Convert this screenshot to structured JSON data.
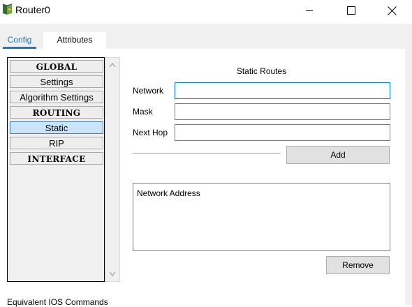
{
  "window": {
    "title": "Router0",
    "icon": "router-app-icon",
    "controls": {
      "minimize": "minimize-icon",
      "maximize": "maximize-icon",
      "close": "close-icon"
    }
  },
  "tabs": [
    {
      "label": "Config",
      "active": true
    },
    {
      "label": "Attributes",
      "active": false
    }
  ],
  "sidebar": {
    "items": [
      {
        "label": "GLOBAL",
        "type": "header"
      },
      {
        "label": "Settings",
        "type": "item"
      },
      {
        "label": "Algorithm Settings",
        "type": "item"
      },
      {
        "label": "ROUTING",
        "type": "header"
      },
      {
        "label": "Static",
        "type": "item",
        "selected": true
      },
      {
        "label": "RIP",
        "type": "item"
      },
      {
        "label": "INTERFACE",
        "type": "header"
      }
    ]
  },
  "static_routes": {
    "title": "Static Routes",
    "network_label": "Network",
    "network_value": "",
    "mask_label": "Mask",
    "mask_value": "",
    "next_hop_label": "Next Hop",
    "next_hop_value": "",
    "add_label": "Add",
    "list_header": "Network Address",
    "remove_label": "Remove"
  },
  "footer": {
    "equivalent_ios_label": "Equivalent IOS Commands"
  },
  "colors": {
    "accent": "#1a78c2",
    "selected_bg": "#cce4f7",
    "panel_bg": "#f0f0f0"
  }
}
